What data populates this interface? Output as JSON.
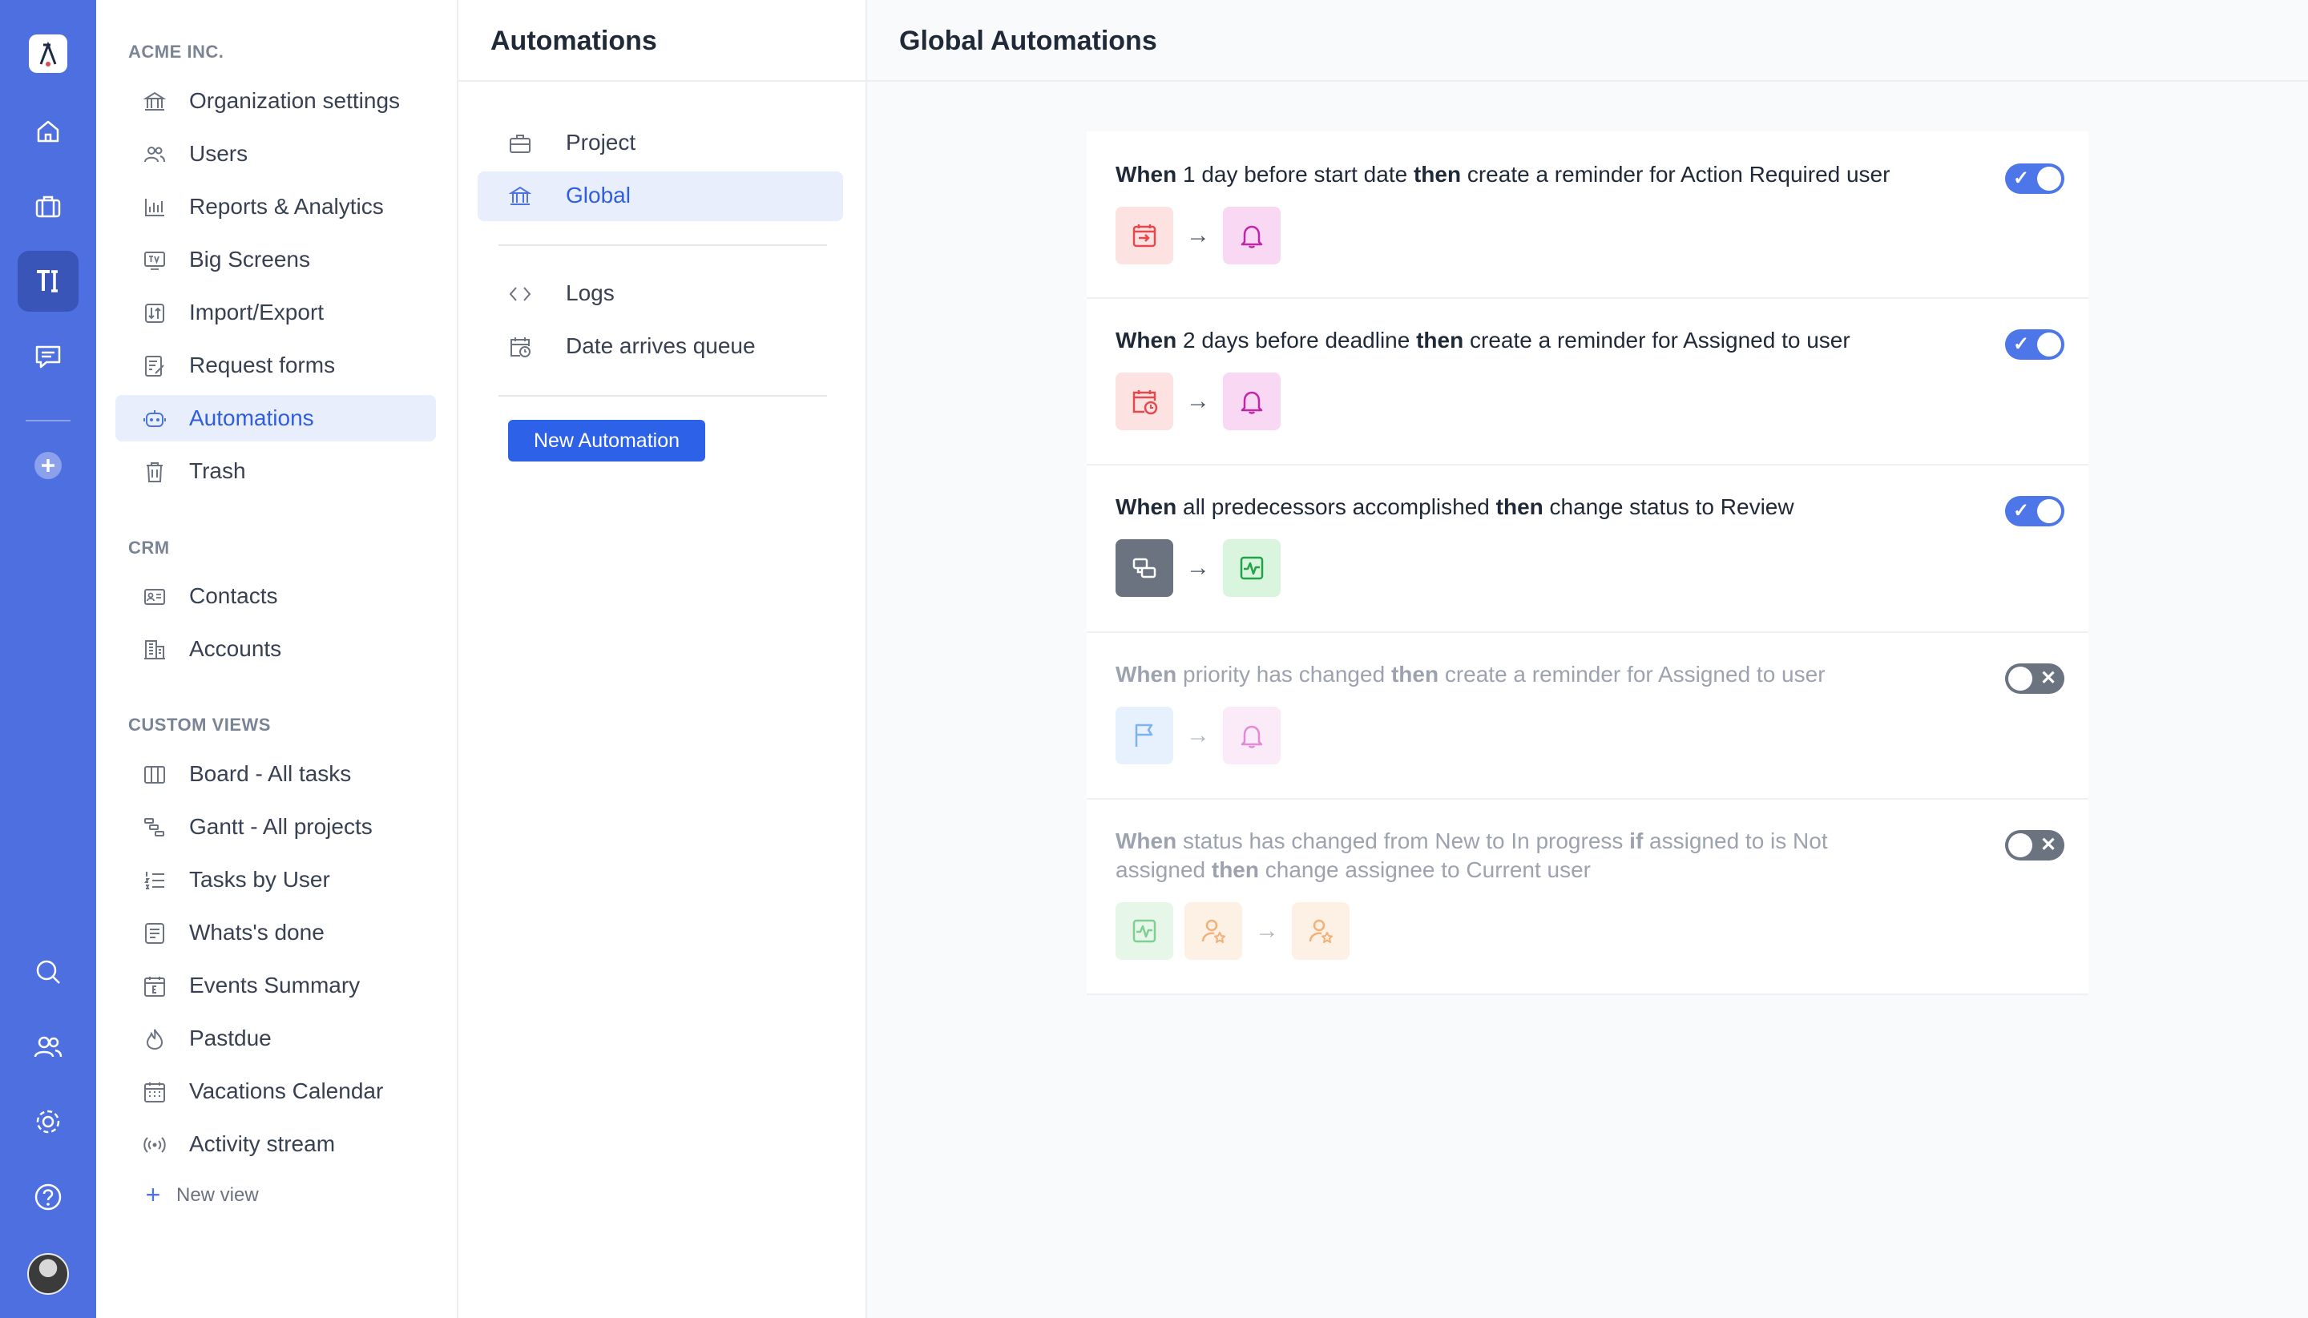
{
  "rail": {
    "items": [
      "home-icon",
      "briefcase-icon",
      "tools-icon",
      "chat-icon",
      "plus-circle-icon",
      "search-icon",
      "users-icon",
      "gear-icon",
      "help-icon"
    ]
  },
  "sidebar": {
    "org_title": "ACME INC.",
    "org_items": [
      {
        "label": "Organization settings",
        "icon": "bank-icon"
      },
      {
        "label": "Users",
        "icon": "users-icon"
      },
      {
        "label": "Reports & Analytics",
        "icon": "bar-chart-icon"
      },
      {
        "label": "Big Screens",
        "icon": "tv-icon"
      },
      {
        "label": "Import/Export",
        "icon": "import-export-icon"
      },
      {
        "label": "Request forms",
        "icon": "form-icon"
      },
      {
        "label": "Automations",
        "icon": "robot-icon",
        "active": true
      },
      {
        "label": "Trash",
        "icon": "trash-icon"
      }
    ],
    "crm_title": "CRM",
    "crm_items": [
      {
        "label": "Contacts",
        "icon": "contact-card-icon"
      },
      {
        "label": "Accounts",
        "icon": "building-icon"
      }
    ],
    "custom_title": "CUSTOM VIEWS",
    "custom_items": [
      {
        "label": "Board - All tasks",
        "icon": "board-icon"
      },
      {
        "label": "Gantt - All projects",
        "icon": "gantt-icon"
      },
      {
        "label": "Tasks by User",
        "icon": "list-numbered-icon"
      },
      {
        "label": "Whats's done",
        "icon": "checklist-icon"
      },
      {
        "label": "Events Summary",
        "icon": "calendar-e-icon"
      },
      {
        "label": "Pastdue",
        "icon": "fire-icon"
      },
      {
        "label": "Vacations Calendar",
        "icon": "calendar-grid-icon"
      },
      {
        "label": "Activity stream",
        "icon": "broadcast-icon"
      }
    ],
    "new_view": "New view"
  },
  "middle": {
    "title": "Automations",
    "items": [
      {
        "label": "Project",
        "icon": "briefcase-icon"
      },
      {
        "label": "Global",
        "icon": "bank-icon",
        "active": true
      }
    ],
    "items2": [
      {
        "label": "Logs",
        "icon": "code-icon"
      },
      {
        "label": "Date arrives queue",
        "icon": "calendar-clock-icon"
      }
    ],
    "new_button": "New Automation"
  },
  "main": {
    "title": "Global Automations",
    "rules": [
      {
        "when": "When",
        "cond": " 1 day before start date ",
        "then": "then",
        "action": " create a reminder for Action Required user",
        "enabled": true,
        "icons": [
          "calendar-start-icon",
          "bell-icon"
        ]
      },
      {
        "when": "When",
        "cond": " 2 days before deadline ",
        "then": "then",
        "action": " create a reminder for Assigned to user",
        "enabled": true,
        "icons": [
          "calendar-clock-icon",
          "bell-icon"
        ]
      },
      {
        "when": "When",
        "cond": " all predecessors accomplished ",
        "then": "then",
        "action": " change status to Review",
        "enabled": true,
        "icons": [
          "dependency-icon",
          "pulse-icon"
        ]
      },
      {
        "when": "When",
        "cond": " priority has changed ",
        "then": "then",
        "action": " create a reminder for Assigned to user",
        "enabled": false,
        "icons": [
          "flag-icon",
          "bell-icon"
        ]
      },
      {
        "when": "When",
        "cond": " status has changed from New to In progress ",
        "if": "if",
        "cond2": " assigned to is Not assigned ",
        "then": "then",
        "action": " change assignee to Current user",
        "enabled": false,
        "icons": [
          "pulse-icon",
          "user-star-icon",
          "user-star-icon"
        ]
      }
    ]
  },
  "colors": {
    "rail": "#4d6fe0",
    "accent": "#2d62e8",
    "toggle_on": "#4d77e8",
    "toggle_off": "#6b7280"
  }
}
